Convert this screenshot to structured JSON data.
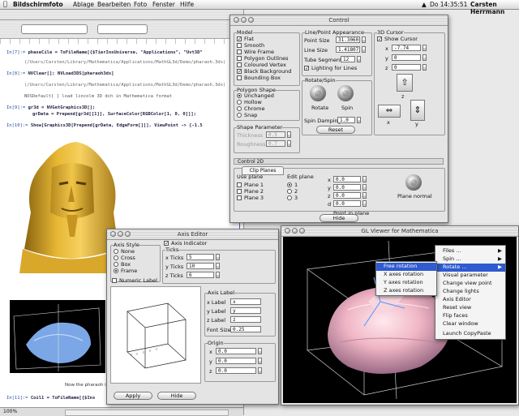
{
  "menubar": {
    "app": "Bildschirmfoto",
    "items": [
      "Ablage",
      "Bearbeiten",
      "Foto",
      "Fenster",
      "Hilfe"
    ],
    "clock": "Do 14:35:51",
    "user": "Carsten Herrmann"
  },
  "notebook": {
    "lines": [
      {
        "label": "In[7]:=",
        "code": "phaseCile = ToFileName[{$TierInsUniverse, \"Applications\", \"Uvt3D\""
      },
      {
        "label": "",
        "code": "(/Users/Carsten/Library/Mathematica/Applications/MathGL3d/Demo/pharaoh.3ds)"
      },
      {
        "label": "In[8]:=",
        "code": "NVClear[]; NVLoad3DS[pharaoh3ds]"
      },
      {
        "label": "",
        "code": "(/Users/Carsten/Library/Mathematica/Applications/MathGL3d/Demo/pharaoh.3ds)"
      },
      {
        "label": "",
        "code": "NOSDefault[ ] load lincolm 3D dch in Mathematica format"
      },
      {
        "label": "In[9]:=",
        "code": "gr3d = NVGetGraphics3D[];"
      },
      {
        "label": "",
        "code": "grData = Prepend[gr3d[[1]], SurfaceColor[RGBColor[1, 0, 0]]];"
      },
      {
        "label": "In[10]:=",
        "code": "Show[Graphics3D[Prepend[grData, EdgeForm[]]], ViewPoint -> {-1.5"
      }
    ],
    "caption": "Now the pharaoh is imported as an initial3D model.",
    "last_line": {
      "label": "In[11]:=",
      "code": "Coil1 = ToFileName[{$Ins"
    },
    "status_zoom": "100%"
  },
  "control": {
    "title": "Control",
    "model": {
      "heading": "Model",
      "options": [
        {
          "label": "Flat",
          "checked": true
        },
        {
          "label": "Smooth",
          "checked": false
        },
        {
          "label": "Wire Frame",
          "checked": false
        },
        {
          "label": "Polygon Outlines",
          "checked": false
        },
        {
          "label": "Coloured Vertex",
          "checked": false
        },
        {
          "label": "Black Background",
          "checked": true
        },
        {
          "label": "Bounding Box",
          "checked": false
        }
      ]
    },
    "polygon": {
      "heading": "Polygon Shape",
      "options": [
        "Unchanged",
        "Hollow",
        "Chrome",
        "Snap"
      ]
    },
    "shape_params": {
      "heading": "Shape Parameter",
      "thickness_label": "Thickness",
      "thickness_value": "0.5",
      "roughness_label": "Roughness",
      "roughness_value": "0.7"
    },
    "lighting": {
      "heading": "Line/Point Appearance",
      "rows": [
        {
          "label": "Point Size",
          "value": "31.3060"
        },
        {
          "label": "Line Size",
          "value": "1.41807"
        },
        {
          "label": "Tube Segments",
          "value": "12"
        }
      ],
      "lighting_label": "Lighting for Lines"
    },
    "rotate": {
      "heading": "Rotate/Spin",
      "rotate_label": "Rotate",
      "spin_label": "Spin",
      "damping_label": "Spin Damping",
      "damping_value": "1.0",
      "reset_label": "Reset"
    },
    "cursor": {
      "heading": "3D Cursor",
      "show_label": "Show Cursor",
      "x_label": "x",
      "x_value": "-7.74",
      "y_label": "y",
      "y_value": "0",
      "z_label": "z",
      "z_value": "0"
    },
    "clip_tab": "Clip Planes",
    "clip_outer": "Control 2D",
    "use_plane_label": "Use plane",
    "edit_plane_label": "Edit plane",
    "planes": [
      "Plane 1",
      "Plane 2",
      "Plane 3"
    ],
    "edit_options": [
      "1",
      "2",
      "3"
    ],
    "clip_fields": [
      {
        "label": "x",
        "value": "0.0"
      },
      {
        "label": "y",
        "value": "0.0"
      },
      {
        "label": "z",
        "value": "0.0"
      },
      {
        "label": "d",
        "value": "0.0"
      }
    ],
    "plane_normal_label": "Plane normal",
    "point_in_plane_label": "Point in plane",
    "hide_label": "Hide"
  },
  "axis_editor": {
    "title": "Axis Editor",
    "axis_style_heading": "Axis Style",
    "styles": [
      "None",
      "Cross",
      "Box",
      "Frame"
    ],
    "axis_indicator_label": "Axis Indicator",
    "ticks_heading": "Ticks",
    "ticks": [
      {
        "label": "x Ticks",
        "value": "5"
      },
      {
        "label": "y Ticks",
        "value": "10"
      },
      {
        "label": "z Ticks",
        "value": "6"
      }
    ],
    "numeric_label": "Numeric Label",
    "axis_label_heading": "Axis Label",
    "labels": [
      {
        "label": "x Label",
        "value": "x"
      },
      {
        "label": "y Label",
        "value": "y"
      },
      {
        "label": "z Label",
        "value": "z"
      }
    ],
    "font_size_label": "Font Size",
    "font_size_value": "0.25",
    "origin_heading": "Origin",
    "origin": [
      {
        "label": "x",
        "value": "0.0"
      },
      {
        "label": "y",
        "value": "0.0"
      },
      {
        "label": "z",
        "value": "0.0"
      }
    ],
    "apply_label": "Apply",
    "hide_label": "Hide"
  },
  "gl_viewer": {
    "title": "GL Viewer for Mathematica"
  },
  "context_menu": {
    "items": [
      {
        "label": "Files ...",
        "arrow": "▶"
      },
      {
        "label": "Spin ...",
        "arrow": "▶"
      },
      {
        "label": "Rotate ...",
        "arrow": "▶"
      },
      {
        "label": "Visual parameter",
        "arrow": ""
      },
      {
        "label": "Change view point",
        "arrow": ""
      },
      {
        "label": "Change lights",
        "arrow": ""
      },
      {
        "label": "Axis Editor",
        "arrow": ""
      },
      {
        "label": "Reset view",
        "arrow": ""
      },
      {
        "label": "Flip faces",
        "arrow": ""
      },
      {
        "label": "Clear window",
        "arrow": ""
      },
      {
        "label": "Launch CopyPaste",
        "arrow": ""
      }
    ],
    "submenu": [
      "Free rotation",
      "X axes rotation",
      "Y axes rotation",
      "Z axes rotation"
    ]
  },
  "colors": {
    "highlight": "#2f5bd0",
    "pharaoh_gold": "#d9a82a",
    "link_blue": "#2a4ea0"
  }
}
